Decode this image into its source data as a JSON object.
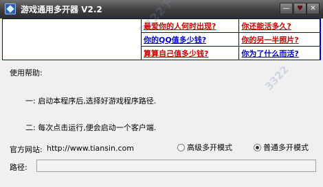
{
  "window": {
    "title": "游戏通用多开器 V2.2",
    "controls": {
      "minimize": "—",
      "heart": "♥",
      "close": "✕"
    }
  },
  "ads": {
    "rows": [
      {
        "left": "最爱你的人何时出现?",
        "left_color": "#cc0000",
        "right": "你还能活多久?",
        "right_color": "#cc0000"
      },
      {
        "left": "你的QQ值多少钱?",
        "left_color": "#0000cc",
        "right": "你的另一半照片?",
        "right_color": "#cc0000"
      },
      {
        "left": "算算自己值多少钱?",
        "left_color": "#cc0000",
        "right": "你为了什么而活?",
        "right_color": "#0000cc"
      }
    ]
  },
  "help": {
    "heading": "使用帮助:",
    "step1": "一: 启动本程序后,选择好游戏程序路径.",
    "step2": "二: 每次点击运行,便会启动一个客户端."
  },
  "website": {
    "label": "官方网站:",
    "url": "http://www.tiansin.com"
  },
  "mode": {
    "options": [
      {
        "label": "高级多开模式",
        "selected": false
      },
      {
        "label": "普通多开模式",
        "selected": true
      }
    ]
  },
  "path": {
    "label": "路径:",
    "value": ""
  },
  "watermark": {
    "text": "3322下载站",
    "text2": "3322"
  }
}
